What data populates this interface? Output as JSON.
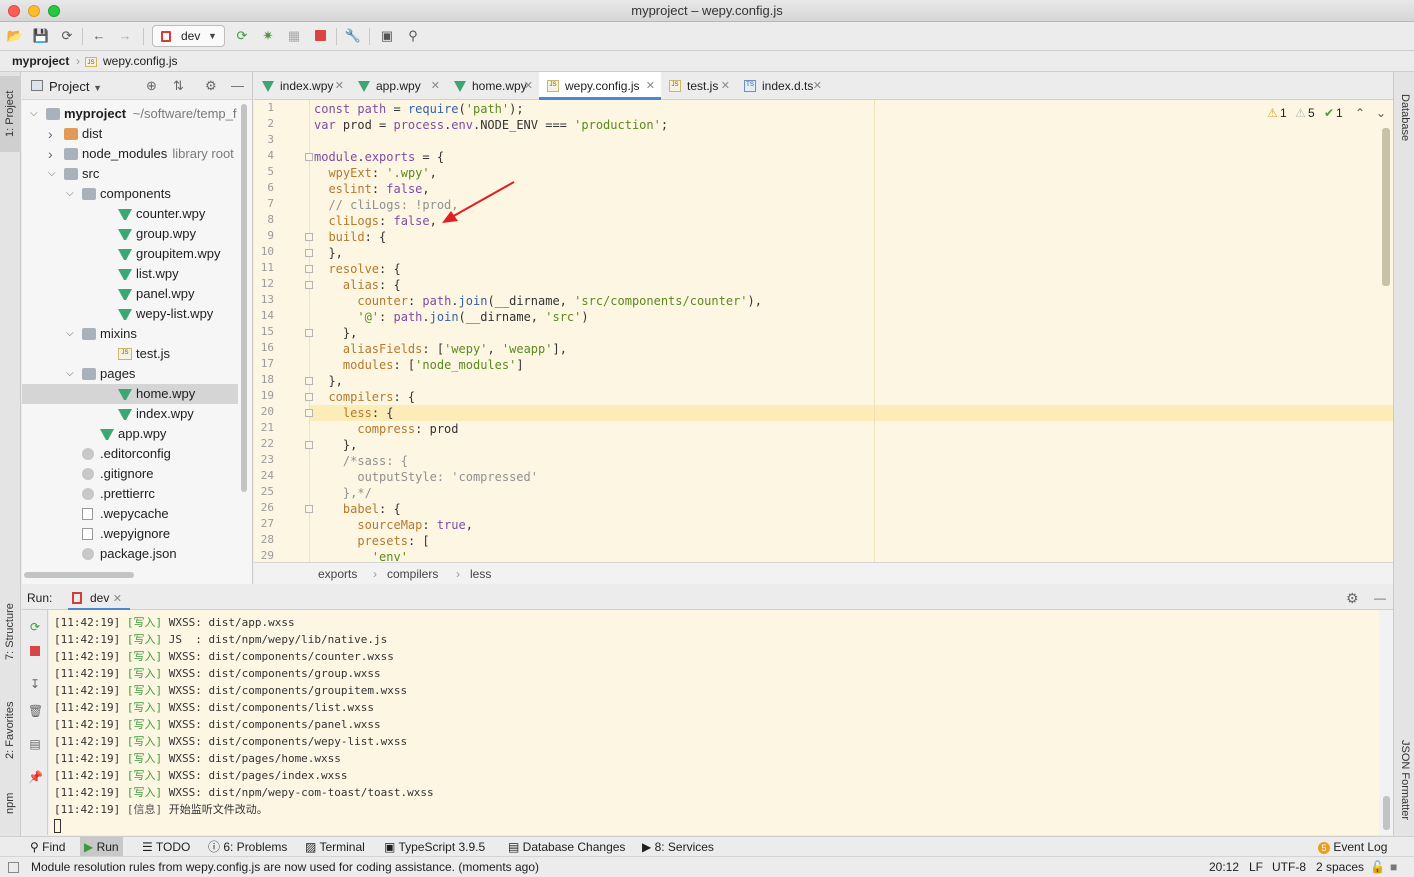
{
  "window": {
    "title": "myproject – wepy.config.js"
  },
  "toolbar": {
    "run_config": "dev"
  },
  "navbar": {
    "project": "myproject",
    "file": "wepy.config.js"
  },
  "left_strip": {
    "project": "1: Project",
    "structure": "7: Structure",
    "favorites": "2: Favorites",
    "npm": "npm"
  },
  "right_strip": {
    "database": "Database",
    "json_formatter": "JSON Formatter"
  },
  "project_panel": {
    "title": "Project",
    "tree": [
      {
        "name": "myproject",
        "sub": "~/software/temp_f",
        "indent": 0,
        "arrow": "down",
        "icon": "folder",
        "bold": true
      },
      {
        "name": "dist",
        "indent": 1,
        "arrow": "right",
        "icon": "folder-orange"
      },
      {
        "name": "node_modules",
        "sub": "library root",
        "indent": 1,
        "arrow": "right",
        "icon": "folder"
      },
      {
        "name": "src",
        "indent": 1,
        "arrow": "down",
        "icon": "folder"
      },
      {
        "name": "components",
        "indent": 2,
        "arrow": "down",
        "icon": "folder"
      },
      {
        "name": "counter.wpy",
        "indent": 4,
        "icon": "vue"
      },
      {
        "name": "group.wpy",
        "indent": 4,
        "icon": "vue"
      },
      {
        "name": "groupitem.wpy",
        "indent": 4,
        "icon": "vue"
      },
      {
        "name": "list.wpy",
        "indent": 4,
        "icon": "vue"
      },
      {
        "name": "panel.wpy",
        "indent": 4,
        "icon": "vue"
      },
      {
        "name": "wepy-list.wpy",
        "indent": 4,
        "icon": "vue"
      },
      {
        "name": "mixins",
        "indent": 2,
        "arrow": "down",
        "icon": "folder"
      },
      {
        "name": "test.js",
        "indent": 4,
        "icon": "js"
      },
      {
        "name": "pages",
        "indent": 2,
        "arrow": "down",
        "icon": "folder"
      },
      {
        "name": "home.wpy",
        "indent": 4,
        "icon": "vue",
        "selected": true
      },
      {
        "name": "index.wpy",
        "indent": 4,
        "icon": "vue"
      },
      {
        "name": "app.wpy",
        "indent": 3,
        "icon": "vue"
      },
      {
        "name": ".editorconfig",
        "indent": 2,
        "icon": "cfg"
      },
      {
        "name": ".gitignore",
        "indent": 2,
        "icon": "cfg"
      },
      {
        "name": ".prettierrc",
        "indent": 2,
        "icon": "cfg"
      },
      {
        "name": ".wepycache",
        "indent": 2,
        "icon": "txt"
      },
      {
        "name": ".wepyignore",
        "indent": 2,
        "icon": "txt"
      },
      {
        "name": "package.json",
        "indent": 2,
        "icon": "cfg"
      }
    ]
  },
  "editor_tabs": [
    {
      "label": "index.wpy",
      "icon": "vue"
    },
    {
      "label": "app.wpy",
      "icon": "vue"
    },
    {
      "label": "home.wpy",
      "icon": "vue"
    },
    {
      "label": "wepy.config.js",
      "icon": "js",
      "active": true
    },
    {
      "label": "test.js",
      "icon": "js"
    },
    {
      "label": "index.d.ts",
      "icon": "ts"
    }
  ],
  "inspections": {
    "warnings": "1",
    "weak_warnings": "5",
    "ok": "1"
  },
  "code": [
    "const path = require('path');",
    "var prod = process.env.NODE_ENV === 'production';",
    "",
    "module.exports = {",
    "  wpyExt: '.wpy',",
    "  eslint: false,",
    "  // cliLogs: !prod,",
    "  cliLogs: false,",
    "  build: {",
    "  },",
    "  resolve: {",
    "    alias: {",
    "      counter: path.join(__dirname, 'src/components/counter'),",
    "      '@': path.join(__dirname, 'src')",
    "    },",
    "    aliasFields: ['wepy', 'weapp'],",
    "    modules: ['node_modules']",
    "  },",
    "  compilers: {",
    "    less: {",
    "      compress: prod",
    "    },",
    "    /*sass: {",
    "      outputStyle: 'compressed'",
    "    },*/",
    "    babel: {",
    "      sourceMap: true,",
    "      presets: [",
    "        'env'"
  ],
  "editor_breadcrumb": [
    "exports",
    "compilers",
    "less"
  ],
  "run_panel": {
    "label": "Run:",
    "tab": "dev",
    "lines": [
      {
        "time": "[11:42:19]",
        "tag": "[写入]",
        "text": "WXSS: dist/app.wxss"
      },
      {
        "time": "[11:42:19]",
        "tag": "[写入]",
        "text": "JS  : dist/npm/wepy/lib/native.js"
      },
      {
        "time": "[11:42:19]",
        "tag": "[写入]",
        "text": "WXSS: dist/components/counter.wxss"
      },
      {
        "time": "[11:42:19]",
        "tag": "[写入]",
        "text": "WXSS: dist/components/group.wxss"
      },
      {
        "time": "[11:42:19]",
        "tag": "[写入]",
        "text": "WXSS: dist/components/groupitem.wxss"
      },
      {
        "time": "[11:42:19]",
        "tag": "[写入]",
        "text": "WXSS: dist/components/list.wxss"
      },
      {
        "time": "[11:42:19]",
        "tag": "[写入]",
        "text": "WXSS: dist/components/panel.wxss"
      },
      {
        "time": "[11:42:19]",
        "tag": "[写入]",
        "text": "WXSS: dist/components/wepy-list.wxss"
      },
      {
        "time": "[11:42:19]",
        "tag": "[写入]",
        "text": "WXSS: dist/pages/home.wxss"
      },
      {
        "time": "[11:42:19]",
        "tag": "[写入]",
        "text": "WXSS: dist/pages/index.wxss"
      },
      {
        "time": "[11:42:19]",
        "tag": "[写入]",
        "text": "WXSS: dist/npm/wepy-com-toast/toast.wxss"
      },
      {
        "time": "[11:42:19]",
        "tag": "[信息]",
        "text": "开始监听文件改动。"
      }
    ]
  },
  "bottom_tools": {
    "find": "Find",
    "run": "Run",
    "todo": "TODO",
    "problems": "6: Problems",
    "terminal": "Terminal",
    "typescript": "TypeScript 3.9.5",
    "db_changes": "Database Changes",
    "services": "8: Services",
    "event_log": "Event Log",
    "event_count": "5"
  },
  "status": {
    "message": "Module resolution rules from wepy.config.js are now used for coding assistance. (moments ago)",
    "position": "20:12",
    "line_sep": "LF",
    "encoding": "UTF-8",
    "indent": "2 spaces"
  },
  "colors": {
    "editor_bg": "#fdf6e3",
    "current_line": "#fcecb8",
    "accent": "#4a88d4",
    "annotation_arrow": "#e02020"
  }
}
